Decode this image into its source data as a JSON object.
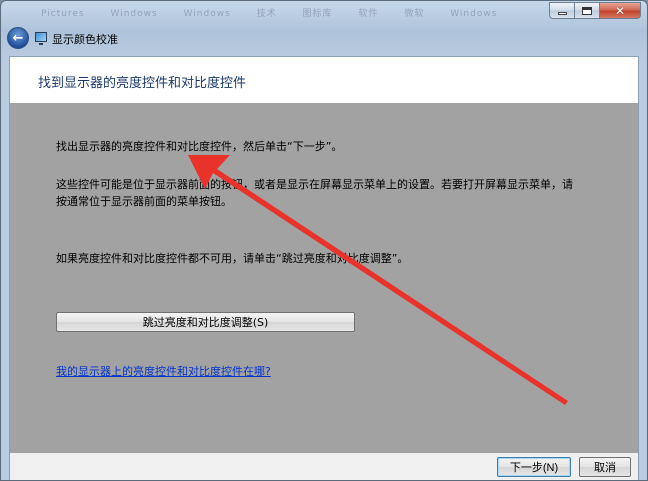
{
  "window": {
    "title": "显示颜色校准",
    "blurred_titlebar_items": [
      "Pictures",
      "Windows",
      "Windows",
      "技术",
      "图标库",
      "软件",
      "微软",
      "Windows"
    ]
  },
  "page": {
    "heading": "找到显示器的亮度控件和对比度控件",
    "instruction": "找出显示器的亮度控件和对比度控件，然后单击“下一步”。",
    "description": "这些控件可能是位于显示器前面的按钮，或者是显示在屏幕显示菜单上的设置。若要打开屏幕显示菜单，请按通常位于显示器前面的菜单按钮。",
    "unavailable_note": "如果亮度控件和对比度控件都不可用，请单击“跳过亮度和对比度调整”。",
    "skip_button": "跳过亮度和对比度调整(S)",
    "help_link": "我的显示器上的亮度控件和对比度控件在哪?"
  },
  "footer": {
    "next_button": "下一步(N)",
    "cancel_button": "取消"
  },
  "colors": {
    "gray_panel": "#a3a2a3",
    "annotation_arrow": "#e8322a",
    "link": "#0033cc",
    "heading": "#1a3a6b"
  },
  "icons": {
    "back": "back-arrow-icon",
    "app": "display-monitor-icon"
  }
}
